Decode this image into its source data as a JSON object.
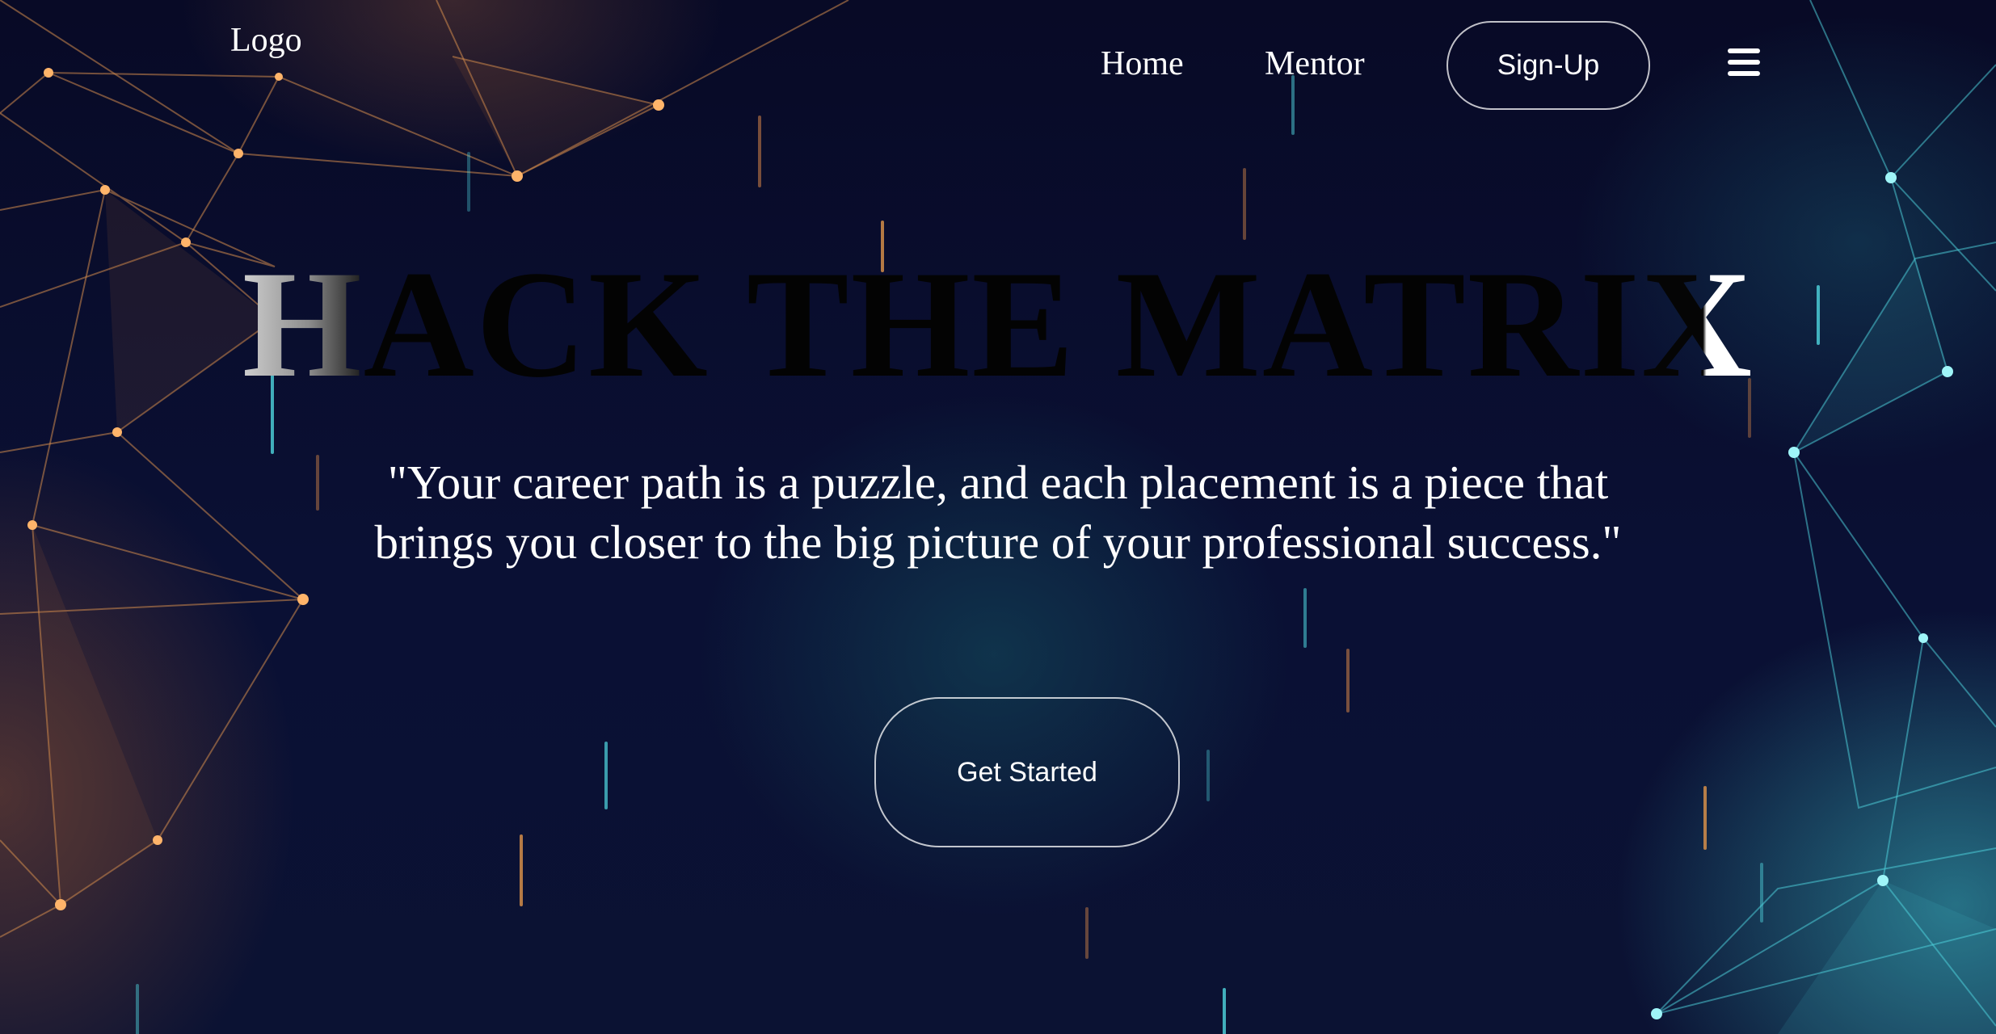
{
  "header": {
    "logo_text": "Logo",
    "nav": [
      {
        "label": "Home"
      },
      {
        "label": "Mentor"
      }
    ],
    "signup_label": "Sign-Up",
    "menu_icon": "hamburger-menu-icon"
  },
  "hero": {
    "title_first": "H",
    "title_middle": "ACK THE MATRI",
    "title_last": "X",
    "quote_line1": "\"Your career path is a puzzle, and each placement is a piece that",
    "quote_line2": "brings you closer to the big picture of your professional success.\"",
    "cta_label": "Get Started"
  },
  "colors": {
    "background": "#070a24",
    "accent_orange": "#e0954a",
    "accent_teal": "#4fd6df",
    "text": "#ffffff"
  }
}
